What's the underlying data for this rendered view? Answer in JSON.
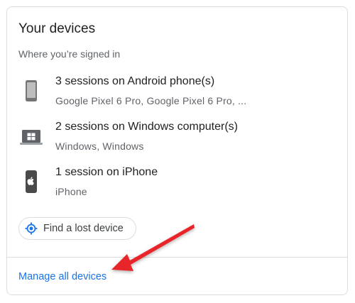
{
  "card": {
    "title": "Your devices",
    "subtitle": "Where you’re signed in"
  },
  "devices": [
    {
      "icon": "android-phone-icon",
      "name": "3 sessions on Android phone(s)",
      "detail": "Google Pixel 6 Pro, Google Pixel 6 Pro, ..."
    },
    {
      "icon": "windows-laptop-icon",
      "name": "2 sessions on Windows computer(s)",
      "detail": "Windows, Windows"
    },
    {
      "icon": "iphone-icon",
      "name": "1 session on iPhone",
      "detail": "iPhone"
    }
  ],
  "find_button": {
    "label": "Find a lost device",
    "icon": "locate-icon"
  },
  "manage_link": {
    "label": "Manage all devices"
  },
  "colors": {
    "link": "#1a73e8",
    "arrow": "#e8262b",
    "border": "#dadce0"
  }
}
